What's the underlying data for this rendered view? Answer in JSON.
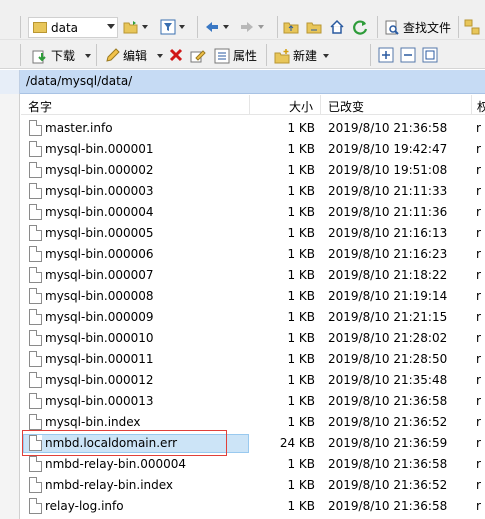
{
  "toolbar1": {
    "folder_combo_value": "data",
    "find_files_label": "查找文件"
  },
  "toolbar2": {
    "download_label": "下载",
    "edit_label": "编辑",
    "properties_label": "属性",
    "new_label": "新建"
  },
  "path": "/data/mysql/data/",
  "columns": {
    "name": "名字",
    "size": "大小",
    "modified": "已改变",
    "truncated": "权"
  },
  "files": [
    {
      "name": "master.info",
      "size": "1 KB",
      "modified": "2019/8/10 21:36:58",
      "extra": "r"
    },
    {
      "name": "mysql-bin.000001",
      "size": "1 KB",
      "modified": "2019/8/10 19:42:47",
      "extra": "r"
    },
    {
      "name": "mysql-bin.000002",
      "size": "1 KB",
      "modified": "2019/8/10 19:51:08",
      "extra": "r"
    },
    {
      "name": "mysql-bin.000003",
      "size": "1 KB",
      "modified": "2019/8/10 21:11:33",
      "extra": "r"
    },
    {
      "name": "mysql-bin.000004",
      "size": "1 KB",
      "modified": "2019/8/10 21:11:36",
      "extra": "r"
    },
    {
      "name": "mysql-bin.000005",
      "size": "1 KB",
      "modified": "2019/8/10 21:16:13",
      "extra": "r"
    },
    {
      "name": "mysql-bin.000006",
      "size": "1 KB",
      "modified": "2019/8/10 21:16:23",
      "extra": "r"
    },
    {
      "name": "mysql-bin.000007",
      "size": "1 KB",
      "modified": "2019/8/10 21:18:22",
      "extra": "r"
    },
    {
      "name": "mysql-bin.000008",
      "size": "1 KB",
      "modified": "2019/8/10 21:19:14",
      "extra": "r"
    },
    {
      "name": "mysql-bin.000009",
      "size": "1 KB",
      "modified": "2019/8/10 21:21:15",
      "extra": "r"
    },
    {
      "name": "mysql-bin.000010",
      "size": "1 KB",
      "modified": "2019/8/10 21:28:02",
      "extra": "r"
    },
    {
      "name": "mysql-bin.000011",
      "size": "1 KB",
      "modified": "2019/8/10 21:28:50",
      "extra": "r"
    },
    {
      "name": "mysql-bin.000012",
      "size": "1 KB",
      "modified": "2019/8/10 21:35:48",
      "extra": "r"
    },
    {
      "name": "mysql-bin.000013",
      "size": "1 KB",
      "modified": "2019/8/10 21:36:58",
      "extra": "r"
    },
    {
      "name": "mysql-bin.index",
      "size": "1 KB",
      "modified": "2019/8/10 21:36:52",
      "extra": "r"
    },
    {
      "name": "nmbd.localdomain.err",
      "size": "24 KB",
      "modified": "2019/8/10 21:36:59",
      "extra": "r"
    },
    {
      "name": "nmbd-relay-bin.000004",
      "size": "1 KB",
      "modified": "2019/8/10 21:36:58",
      "extra": "r"
    },
    {
      "name": "nmbd-relay-bin.index",
      "size": "1 KB",
      "modified": "2019/8/10 21:36:52",
      "extra": "r"
    },
    {
      "name": "relay-log.info",
      "size": "1 KB",
      "modified": "2019/8/10 21:36:58",
      "extra": "r"
    }
  ],
  "colors": {
    "selection": "#cce4f7",
    "annotation_box": "#e0403a",
    "pathbar": "#c6dbf4"
  }
}
